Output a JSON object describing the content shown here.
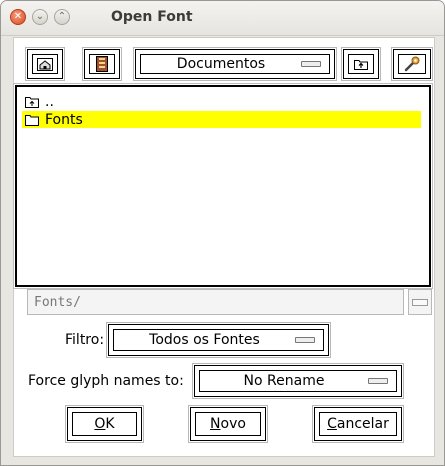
{
  "window": {
    "title": "Open Font",
    "controls": [
      "close",
      "minimize",
      "maximize"
    ]
  },
  "toolbar": {
    "home_icon": "home-icon",
    "bookmark_icon": "bookmark-icon",
    "location_value": "Documentos",
    "parent_icon": "parent-folder-icon",
    "settings_icon": "tools-icon"
  },
  "file_list": {
    "items": [
      {
        "name": "..",
        "icon": "parent-folder-icon",
        "selected": false
      },
      {
        "name": "Fonts",
        "icon": "folder-icon",
        "selected": true
      }
    ]
  },
  "path_field": {
    "value": "Fonts/"
  },
  "filter": {
    "label": "Filtro:",
    "value": "Todos os Fontes"
  },
  "glyph_names": {
    "label": "Force glyph names to:",
    "value": "No Rename"
  },
  "buttons": {
    "ok_mnemonic": "O",
    "ok_rest": "K",
    "new_mnemonic": "N",
    "new_rest": "ovo",
    "cancel_mnemonic": "C",
    "cancel_rest": "ancelar"
  },
  "colors": {
    "selection": "#ffff00",
    "close_button": "#df4c24"
  }
}
